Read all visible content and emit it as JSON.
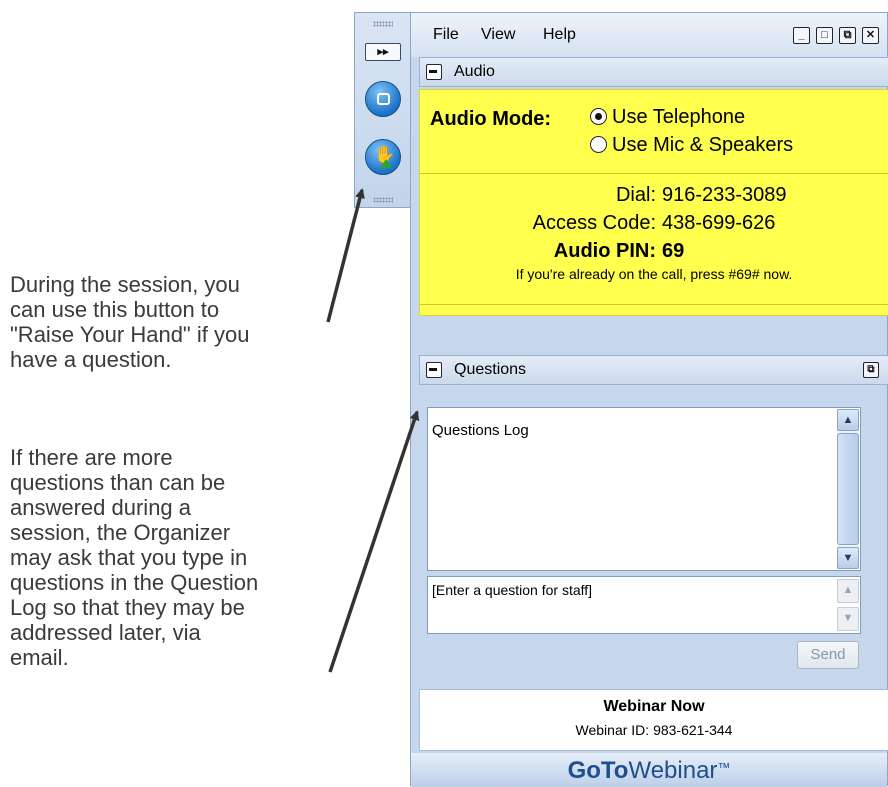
{
  "annotations": {
    "raise_hand": [
      "During the session, you",
      "can use this button to",
      "\"Raise Your Hand\" if you",
      "have a question."
    ],
    "questions": [
      "If there are more",
      "questions than can be",
      "answered during a",
      "session, the Organizer",
      "may ask that you type in",
      "questions in the Question",
      "Log so that they may be",
      "addressed later, via",
      "email."
    ]
  },
  "toolstrip": {
    "expand_label": "▸▸",
    "icons": [
      "screen-share-icon",
      "raise-hand-icon"
    ]
  },
  "menu": {
    "file": "File",
    "view": "View",
    "help": "Help"
  },
  "window_controls": {
    "minimize": "_",
    "maximize": "□",
    "popout": "⧉",
    "close": "✕"
  },
  "audio": {
    "section_title": "Audio",
    "mode_label": "Audio Mode:",
    "options": [
      {
        "label": "Use Telephone",
        "selected": true
      },
      {
        "label": "Use Mic & Speakers",
        "selected": false
      }
    ],
    "dial_label": "Dial:",
    "dial_value": "916-233-3089",
    "access_label": "Access Code:",
    "access_value": "438-699-626",
    "pin_label": "Audio PIN:",
    "pin_value": "69",
    "call_note": "If you're already on the call, press #69# now.",
    "background_color": "#ffff4e"
  },
  "questions": {
    "section_title": "Questions",
    "log_text": "Questions Log",
    "input_placeholder": "[Enter a question for staff]",
    "send_label": "Send"
  },
  "webinar": {
    "title": "Webinar Now",
    "id_text": "Webinar ID: 983-621-344"
  },
  "brand": {
    "part1": "GoTo",
    "part2": "Webinar",
    "tm": "™"
  }
}
